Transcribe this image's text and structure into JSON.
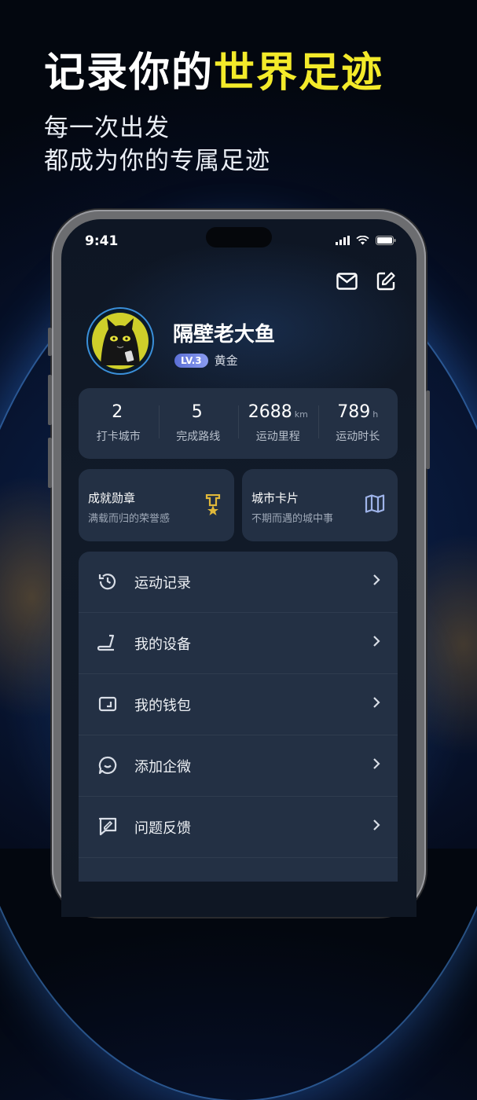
{
  "hero": {
    "title_main": "记录你的",
    "title_highlight": "世界足迹",
    "subtitle_line1": "每一次出发",
    "subtitle_line2": "都成为你的专属足迹"
  },
  "status_bar": {
    "time": "9:41"
  },
  "top_actions": {
    "mail_icon": "mail-icon",
    "edit_icon": "edit-icon"
  },
  "profile": {
    "name": "隔壁老大鱼",
    "level_badge": "LV.3",
    "level_name": "黄金",
    "avatar_icon": "black-cat-avatar"
  },
  "stats": [
    {
      "value": "2",
      "unit": "",
      "label": "打卡城市"
    },
    {
      "value": "5",
      "unit": "",
      "label": "完成路线"
    },
    {
      "value": "2688",
      "unit": "km",
      "label": "运动里程"
    },
    {
      "value": "789",
      "unit": "h",
      "label": "运动时长"
    }
  ],
  "cards": [
    {
      "title": "成就勋章",
      "subtitle": "满载而归的荣誉感",
      "icon": "medal-icon"
    },
    {
      "title": "城市卡片",
      "subtitle": "不期而遇的城中事",
      "icon": "map-icon"
    }
  ],
  "menu": [
    {
      "label": "运动记录",
      "icon": "history-icon"
    },
    {
      "label": "我的设备",
      "icon": "treadmill-icon"
    },
    {
      "label": "我的钱包",
      "icon": "wallet-icon"
    },
    {
      "label": "添加企微",
      "icon": "chat-smile-icon"
    },
    {
      "label": "问题反馈",
      "icon": "feedback-icon"
    }
  ],
  "colors": {
    "highlight": "#f3ea2a",
    "card_bg": "#233044",
    "screen_bg": "#111a28",
    "level_badge": "#6b7fe0"
  }
}
